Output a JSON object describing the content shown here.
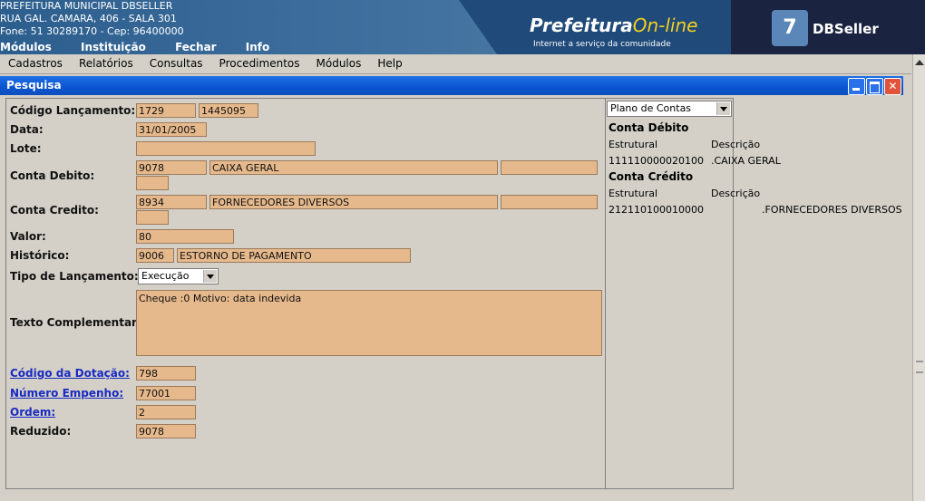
{
  "header": {
    "org_name": "PREFEITURA MUNICIPAL DBSELLER",
    "address": "RUA GAL. CAMARA, 406 - SALA 301",
    "phone_line": "Fone: 51 30289170  -  Cep: 96400000",
    "top_nav": [
      "Módulos",
      "Instituição",
      "Fechar",
      "Info"
    ],
    "prefeitura_brand_main": "Prefeitura",
    "prefeitura_brand_accent": "On-line",
    "prefeitura_tagline": "Internet a serviço da comunidade",
    "dbseller_brand": "DBSeller"
  },
  "menu": [
    "Cadastros",
    "Relatórios",
    "Consultas",
    "Procedimentos",
    "Módulos",
    "Help"
  ],
  "window": {
    "title": "Pesquisa",
    "close_glyph": "✕"
  },
  "form": {
    "codigo_lancamento": {
      "label": "Código Lançamento:",
      "value1": "1729",
      "value2": "1445095"
    },
    "data": {
      "label": "Data:",
      "value": "31/01/2005"
    },
    "lote": {
      "label": "Lote:",
      "value": ""
    },
    "conta_debito": {
      "label": "Conta Debito:",
      "code": "9078",
      "name": "CAIXA GERAL",
      "extra1": "",
      "extra2": ""
    },
    "conta_credito": {
      "label": "Conta Credito:",
      "code": "8934",
      "name": "FORNECEDORES DIVERSOS",
      "extra1": "",
      "extra2": ""
    },
    "valor": {
      "label": "Valor:",
      "value": "80"
    },
    "historico": {
      "label": "Histórico:",
      "code": "9006",
      "text": "ESTORNO DE PAGAMENTO"
    },
    "tipo_lancamento": {
      "label": "Tipo de Lançamento:",
      "selected": "Execução"
    },
    "texto_complementar": {
      "label": "Texto Complementar:",
      "value": "Cheque :0 Motivo: data indevida"
    },
    "codigo_dotacao": {
      "label": "Código da Dotação:",
      "value": "798"
    },
    "numero_empenho": {
      "label": "Número Empenho:",
      "value": "77001"
    },
    "ordem": {
      "label": "Ordem:",
      "value": "2"
    },
    "reduzido": {
      "label": "Reduzido:",
      "value": "9078"
    }
  },
  "side_panel": {
    "select": "Plano de Contas",
    "debito_heading": "Conta Débito",
    "col_estrutural": "Estrutural",
    "col_descricao": "Descrição",
    "debito_estrutural": "111110000020100",
    "debito_descricao": ".CAIXA GERAL",
    "credito_heading": "Conta Crédito",
    "credito_estrutural": "212110100010000",
    "credito_descricao": ".FORNECEDORES DIVERSOS"
  },
  "colors": {
    "field_bg": "#e6b98c",
    "titlebar": "#0a54d0",
    "link": "#1a2bc2"
  },
  "icons": [
    "minimize-icon",
    "maximize-icon",
    "close-icon",
    "dropdown-arrow-icon"
  ]
}
